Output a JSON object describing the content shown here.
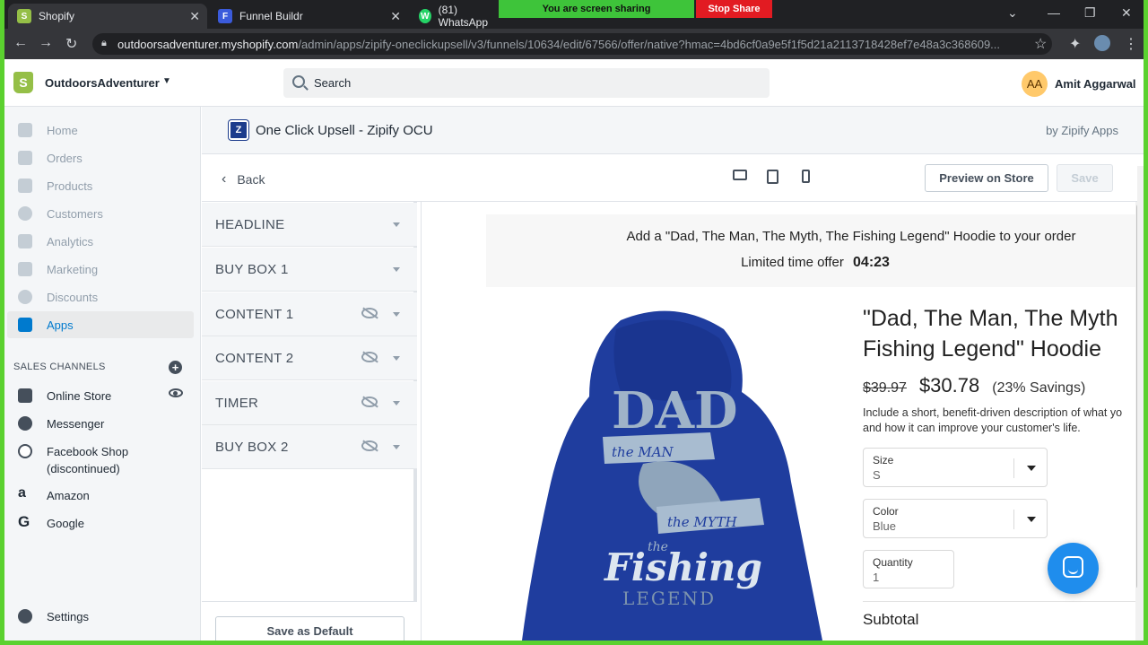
{
  "browser": {
    "tabs": [
      {
        "title": "Shopify",
        "fav": "S",
        "color": "#95bf47"
      },
      {
        "title": "Funnel Buildr",
        "fav": "F",
        "color": "#3b5bdb"
      },
      {
        "title": "(81) WhatsApp",
        "fav": "W",
        "color": "#25d366"
      }
    ],
    "screen_share_text": "You are screen sharing",
    "stop_share_label": "Stop Share",
    "url_host": "outdoorsadventurer.myshopify.com",
    "url_path": "/admin/apps/zipify-oneclickupsell/v3/funnels/10634/edit/67566/offer/native?hmac=4bd6cf0a9e5f1f5d21a2113718428ef7e48a3c368609..."
  },
  "topbar": {
    "store_name": "OutdoorsAdventurer",
    "search_placeholder": "Search",
    "avatar_initials": "AA",
    "user_name": "Amit Aggarwal"
  },
  "sidebar": {
    "items": [
      {
        "label": "Home"
      },
      {
        "label": "Orders"
      },
      {
        "label": "Products"
      },
      {
        "label": "Customers"
      },
      {
        "label": "Analytics"
      },
      {
        "label": "Marketing"
      },
      {
        "label": "Discounts"
      },
      {
        "label": "Apps"
      }
    ],
    "sales_channels_label": "SALES CHANNELS",
    "channels": [
      {
        "label": "Online Store"
      },
      {
        "label": "Messenger"
      },
      {
        "label": "Facebook Shop"
      },
      {
        "label": "(discontinued)"
      },
      {
        "label": "Amazon"
      },
      {
        "label": "Google"
      }
    ],
    "settings_label": "Settings"
  },
  "app": {
    "logo_letter": "Z",
    "title": "One Click Upsell - Zipify OCU",
    "by": "by Zipify Apps"
  },
  "toolbar": {
    "back_label": "Back",
    "preview_label": "Preview on Store",
    "save_label": "Save"
  },
  "sections": [
    {
      "label": "HEADLINE"
    },
    {
      "label": "BUY BOX 1"
    },
    {
      "label": "CONTENT 1"
    },
    {
      "label": "CONTENT 2"
    },
    {
      "label": "TIMER"
    },
    {
      "label": "BUY BOX 2"
    }
  ],
  "save_default_label": "Save as Default",
  "offer": {
    "headline": "Add a \"Dad, The Man, The Myth, The Fishing Legend\" Hoodie to your order",
    "timer_label": "Limited time offer",
    "timer_value": "04:23",
    "product_title_line1": "\"Dad, The Man, The Myth",
    "product_title_line2": "Fishing Legend\" Hoodie",
    "old_price": "$39.97",
    "new_price": "$30.78",
    "savings": "(23% Savings)",
    "description_line1": "Include a short, benefit-driven description of what yo",
    "description_line2": "and how it can improve your customer's life.",
    "size_label": "Size",
    "size_value": "S",
    "color_label": "Color",
    "color_value": "Blue",
    "quantity_label": "Quantity",
    "quantity_value": "1",
    "subtotal_label": "Subtotal",
    "hoodie_text_dad": "DAD",
    "hoodie_text_man": "the MAN",
    "hoodie_text_myth": "the MYTH",
    "hoodie_text_the": "the",
    "hoodie_text_fishing": "Fishing",
    "hoodie_text_legend": "LEGEND"
  }
}
